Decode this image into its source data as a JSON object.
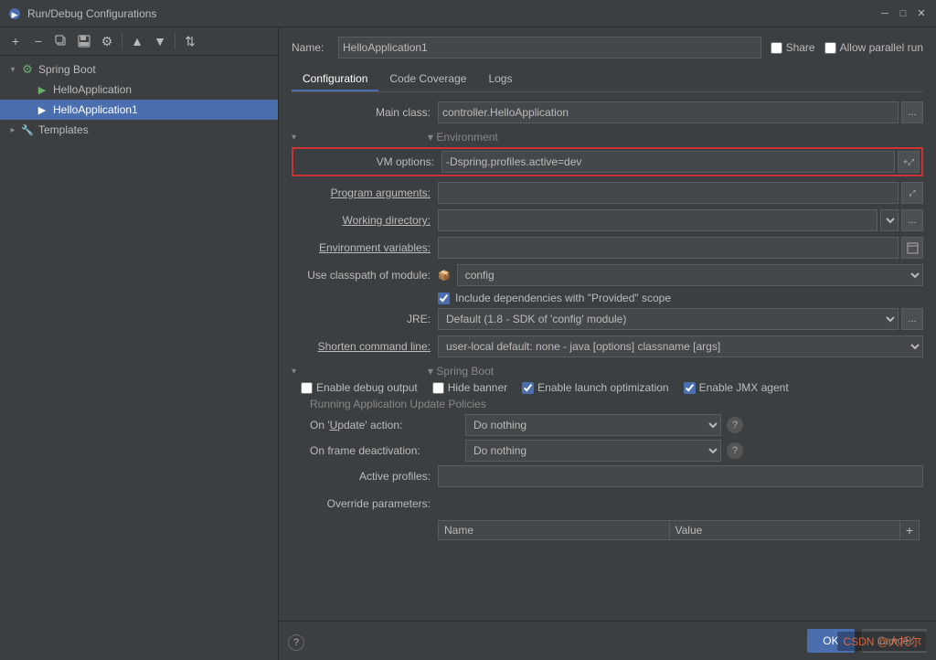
{
  "titleBar": {
    "title": "Run/Debug Configurations",
    "closeBtn": "✕",
    "minimizeBtn": "─",
    "maximizeBtn": "□"
  },
  "toolbar": {
    "addBtn": "+",
    "removeBtn": "−",
    "copyBtn": "⧉",
    "saveBtn": "💾",
    "configBtn": "⚙",
    "upBtn": "▲",
    "downBtn": "▼",
    "sortBtn": "⇅"
  },
  "tree": {
    "items": [
      {
        "id": "spring-boot",
        "label": "Spring Boot",
        "level": 1,
        "expanded": true,
        "type": "folder"
      },
      {
        "id": "hello-app",
        "label": "HelloApplication",
        "level": 2,
        "type": "run"
      },
      {
        "id": "hello-app1",
        "label": "HelloApplication1",
        "level": 2,
        "type": "run",
        "selected": true
      },
      {
        "id": "templates",
        "label": "Templates",
        "level": 1,
        "type": "folder-templates"
      }
    ]
  },
  "form": {
    "nameLabel": "Name:",
    "nameValue": "HelloApplication1",
    "shareLabel": "Share",
    "allowParallelLabel": "Allow parallel run",
    "tabs": [
      "Configuration",
      "Code Coverage",
      "Logs"
    ],
    "activeTab": "Configuration",
    "mainClassLabel": "Main class:",
    "mainClassValue": "controller.HelloApplication",
    "environmentLabel": "▾ Environment",
    "vmOptionsLabel": "VM options:",
    "vmOptionsValue": "-Dspring.profiles.active=dev",
    "programArgsLabel": "Program arguments:",
    "workingDirLabel": "Working directory:",
    "envVarsLabel": "Environment variables:",
    "classpathLabel": "Use classpath of module:",
    "classpathValue": "⬜ config",
    "includeProvided": "Include dependencies with \"Provided\" scope",
    "jreLabel": "JRE:",
    "jreValue": "Default (1.8 - SDK of 'config' module)",
    "shortenCmdLabel": "Shorten command line:",
    "shortenCmdValue": "user-local default: none - java [options] classname [args]",
    "springBootLabel": "▾ Spring Boot",
    "enableDebugLabel": "Enable debug output",
    "hideBannerLabel": "Hide banner",
    "enableLaunchLabel": "Enable launch optimization",
    "enableJmxLabel": "Enable JMX agent",
    "runningPoliciesTitle": "Running Application Update Policies",
    "onUpdateLabel": "On 'Update' action:",
    "onUpdateValue": "Do nothing",
    "onFrameLabel": "On frame deactivation:",
    "onFrameValue": "Do nothing",
    "activeProfilesLabel": "Active profiles:",
    "overrideParamsLabel": "Override parameters:",
    "tableHeaders": [
      "Name",
      "Value"
    ],
    "addRowBtn": "+"
  },
  "bottomBar": {
    "helpBtn": "?",
    "okBtn": "OK",
    "cancelBtn": "Cancel"
  },
  "watermark": "CSDN @大托尔",
  "icons": {
    "run": "▶",
    "folder": "📁",
    "springBoot": "🍃",
    "help": "?",
    "expand": "▾",
    "collapse": "▸",
    "module": "📦",
    "dropdown": "▾",
    "moreBtn": "...",
    "plusExpand": "+",
    "copy-icon": "⧉",
    "save-icon": "💾"
  }
}
